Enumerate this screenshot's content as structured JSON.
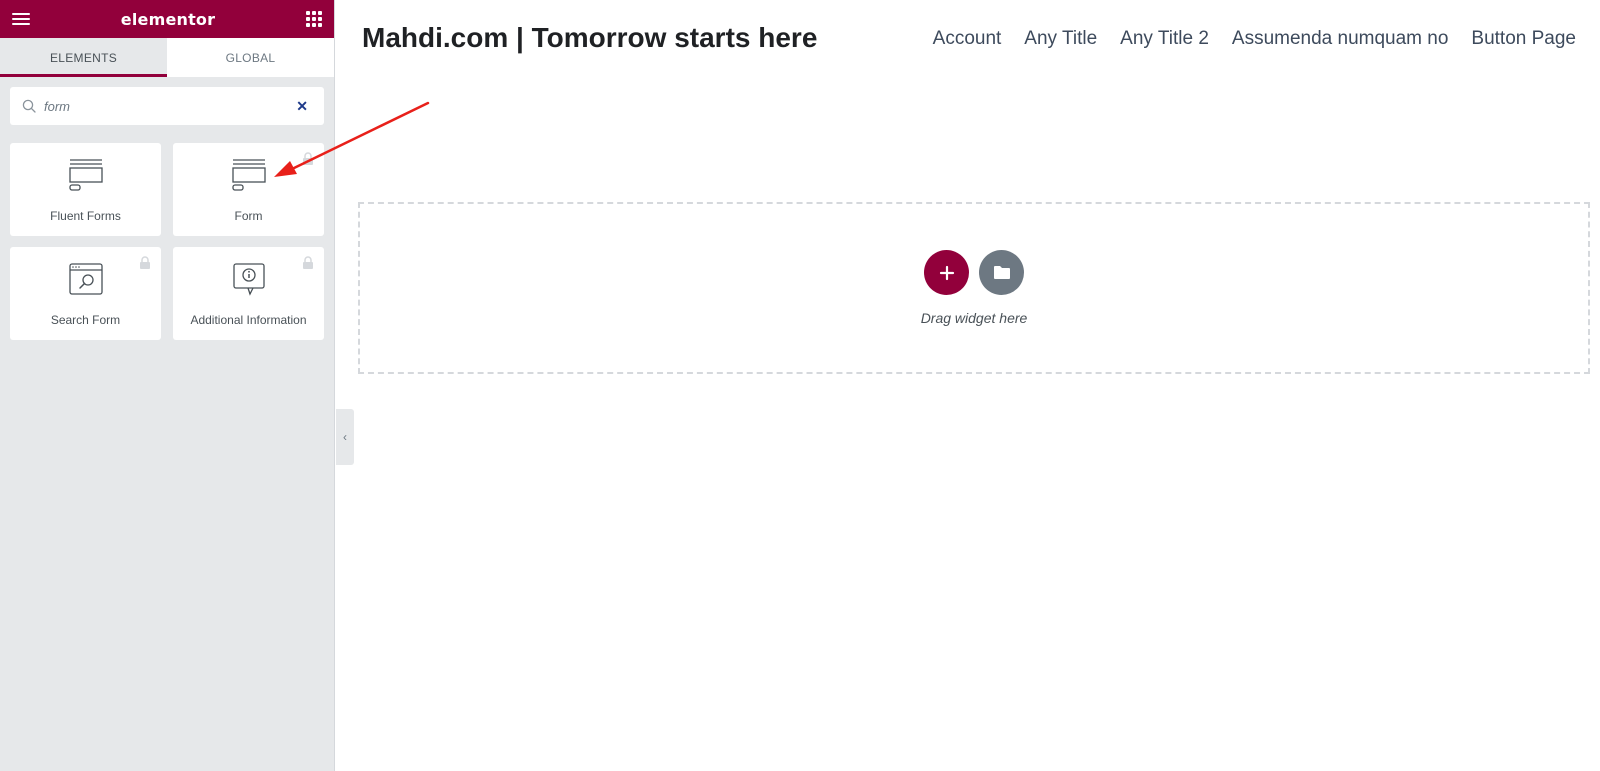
{
  "panel": {
    "logo": "elementor",
    "tabs": [
      {
        "label": "ELEMENTS"
      },
      {
        "label": "GLOBAL"
      }
    ],
    "search": {
      "value": "form"
    },
    "widgets": [
      {
        "label": "Fluent Forms",
        "locked": false
      },
      {
        "label": "Form",
        "locked": true
      },
      {
        "label": "Search Form",
        "locked": true
      },
      {
        "label": "Additional Information",
        "locked": true
      }
    ]
  },
  "site": {
    "title": "Mahdi.com | Tomorrow starts here",
    "nav": [
      "Account",
      "Any Title",
      "Any Title 2",
      "Assumenda numquam no",
      "Button Page"
    ]
  },
  "dropzone": {
    "text": "Drag widget here"
  },
  "colors": {
    "brand": "#92003b",
    "panel_bg": "#e6e8ea",
    "folder_button": "#6d7882",
    "annotation_arrow": "#e8201a"
  }
}
